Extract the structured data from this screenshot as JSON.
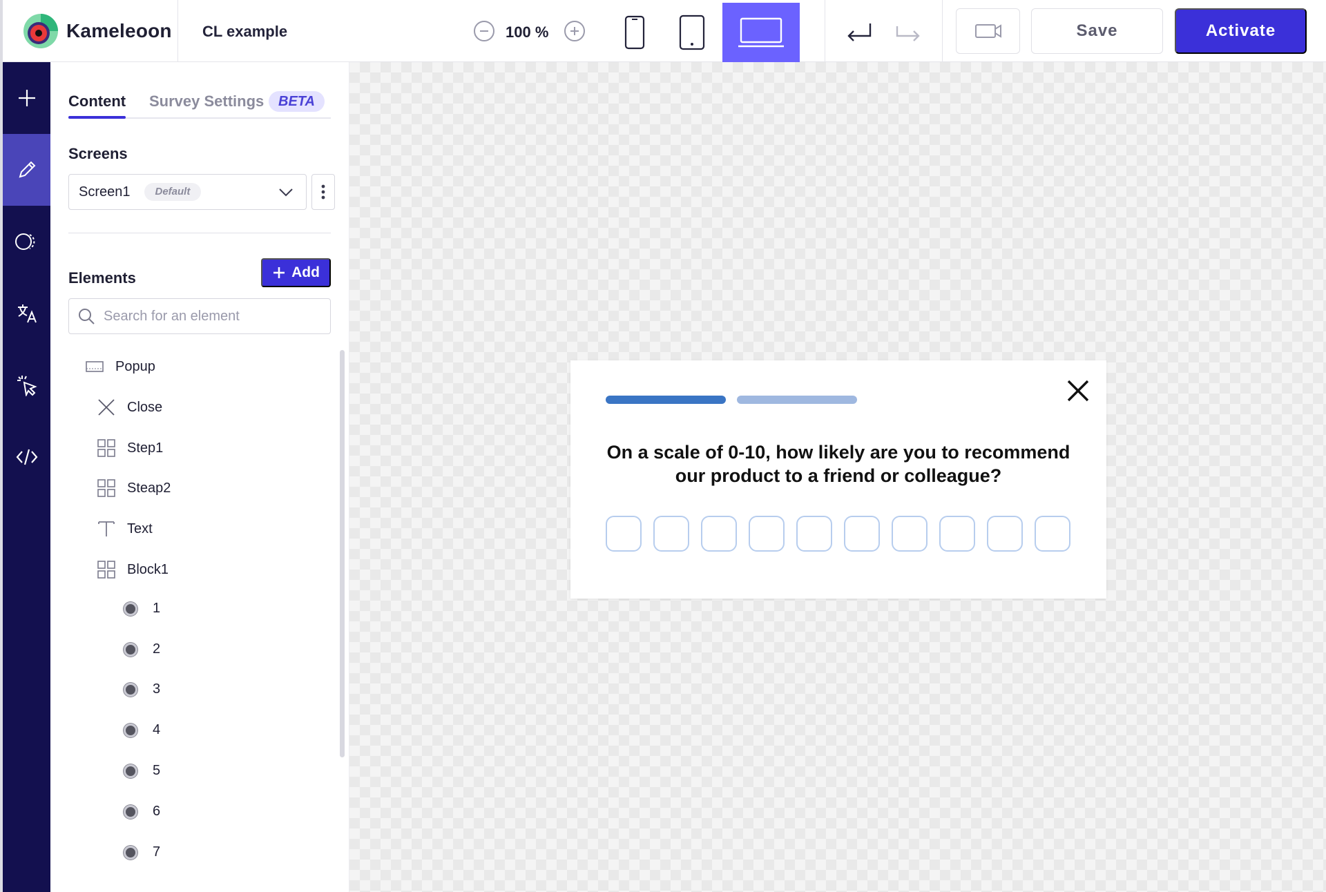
{
  "app": {
    "name": "Kameleoon",
    "project_title": "CL example"
  },
  "toolbar": {
    "zoom_level": "100 %",
    "zoom_out_icon": "minus-circle-icon",
    "zoom_in_icon": "plus-circle-icon",
    "devices": [
      "mobile",
      "tablet",
      "desktop"
    ],
    "active_device": "desktop",
    "save_label": "Save",
    "activate_label": "Activate"
  },
  "rail": {
    "items": [
      {
        "icon": "plus-icon",
        "active": false
      },
      {
        "icon": "pencil-icon",
        "active": true
      },
      {
        "icon": "toggle-icon",
        "active": false
      },
      {
        "icon": "translate-icon",
        "active": false
      },
      {
        "icon": "cursor-click-icon",
        "active": false
      },
      {
        "icon": "code-icon",
        "active": false
      }
    ]
  },
  "panel": {
    "tabs": {
      "content": "Content",
      "survey_settings": "Survey Settings",
      "beta": "BETA"
    },
    "screens_title": "Screens",
    "screen_select": {
      "value": "Screen1",
      "badge": "Default"
    },
    "elements_title": "Elements",
    "add_label": "Add",
    "search_placeholder": "Search for an element",
    "tree": [
      {
        "label": "Popup",
        "icon": "popup-icon"
      },
      {
        "label": "Close",
        "icon": "close-icon"
      },
      {
        "label": "Step1",
        "icon": "grid-icon"
      },
      {
        "label": "Steap2",
        "icon": "grid-icon"
      },
      {
        "label": "Text",
        "icon": "text-icon"
      },
      {
        "label": "Block1",
        "icon": "grid-icon"
      },
      {
        "label": "1",
        "icon": "radio-icon"
      },
      {
        "label": "2",
        "icon": "radio-icon"
      },
      {
        "label": "3",
        "icon": "radio-icon"
      },
      {
        "label": "4",
        "icon": "radio-icon"
      },
      {
        "label": "5",
        "icon": "radio-icon"
      },
      {
        "label": "6",
        "icon": "radio-icon"
      },
      {
        "label": "7",
        "icon": "radio-icon"
      }
    ]
  },
  "popup": {
    "question": "On a scale of 0-10, how likely are you to recommend our product to a friend or colleague?",
    "progress_steps": 2,
    "scale_boxes": 10
  },
  "colors": {
    "brand_primary": "#3b30d9",
    "rail_bg": "#13104f",
    "rail_active": "#4a45b8",
    "device_active": "#6b62ff",
    "progress_active": "#3a75c4",
    "progress_inactive": "#9fb8e0",
    "scale_border": "#b7cdee"
  }
}
